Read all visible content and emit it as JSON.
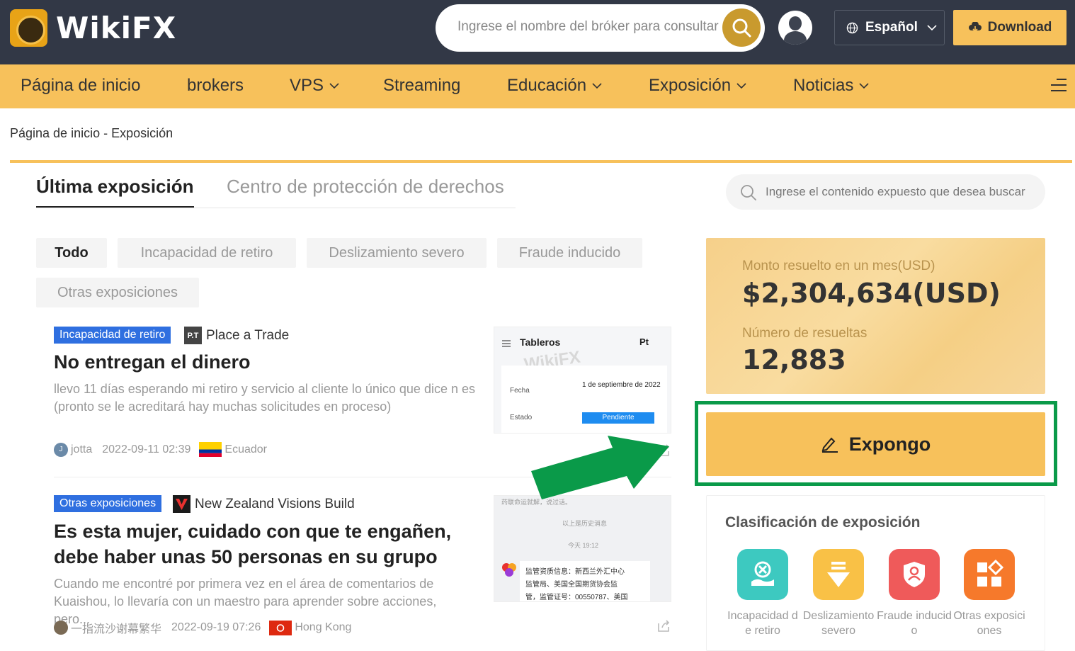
{
  "header": {
    "brand": "WikiFX",
    "search_placeholder": "Ingrese el nombre del bróker para consultar",
    "language": "Español",
    "download": "Download"
  },
  "nav": {
    "items": [
      {
        "label": "Página de inicio"
      },
      {
        "label": "brokers"
      },
      {
        "label": "VPS"
      },
      {
        "label": "Streaming"
      },
      {
        "label": "Educación"
      },
      {
        "label": "Exposición"
      },
      {
        "label": "Noticias"
      }
    ]
  },
  "breadcrumb": "Página de inicio - Exposición",
  "tabs": {
    "active": "Última exposición",
    "other": "Centro de protección de derechos"
  },
  "content_search_placeholder": "Ingrese el contenido expuesto que desea buscar",
  "filters": [
    "Todo",
    "Incapacidad de retiro",
    "Deslizamiento severo",
    "Fraude inducido",
    "Otras exposiciones"
  ],
  "articles": [
    {
      "badge": "Incapacidad de retiro",
      "broker_logo": "P.T",
      "broker": "Place a Trade",
      "title": "No entregan el dinero",
      "desc": "llevo 11 días esperando mi retiro y servicio al cliente lo único que dice n es (pronto se le acreditará hay muchas solicitudes en proceso)",
      "user_initial": "J",
      "user": "jotta",
      "date": "2022-09-11 02:39",
      "country": "Ecuador",
      "thumb": {
        "heading": "Tableros",
        "logo_text": "Pt",
        "watermark": "WikiFX",
        "row1_label": "Fecha",
        "row1_value": "1 de septiembre de 2022",
        "row2_label": "Estado",
        "row2_value": "Pendiente"
      }
    },
    {
      "badge": "Otras exposiciones",
      "broker": "New Zealand Visions Build",
      "title": "Es esta mujer, cuidado con que te engañen, debe haber unas 50 personas en su grupo",
      "desc": "Cuando me encontré por primera vez en el área de comentarios de Kuaishou, lo llevaría con un maestro para aprender sobre acciones, pero...",
      "user": "一指流沙谢幕繁华",
      "date": "2022-09-19 07:26",
      "country": "Hong Kong",
      "thumb": {
        "line1": "药联命运就解，说过话。",
        "line2": "以上是历史消息",
        "line3": "今天 19:12",
        "line4": "监管资质信息：新西兰外汇中心",
        "line5": "监管局、美国全国期货协会监",
        "line6": "管，监管证号：00550787、美国"
      }
    }
  ],
  "stats": {
    "amount_label": "Monto resuelto en un mes(USD)",
    "amount_value": "$2,304,634(USD)",
    "count_label": "Número de resueltas",
    "count_value": "12,883"
  },
  "expose_button": "Expongo",
  "classification": {
    "title": "Clasificación de exposición",
    "items": [
      {
        "label": "Incapacidad de retiro",
        "color": "#3dc9c0"
      },
      {
        "label": "Deslizamiento severo",
        "color": "#f9c146"
      },
      {
        "label": "Fraude inducido",
        "color": "#ef5a5a"
      },
      {
        "label": "Otras exposiciones",
        "color": "#f6792b"
      }
    ]
  },
  "colors": {
    "header_bg": "#323846",
    "accent": "#f7c15b",
    "badge_blue": "#2f6fe0",
    "highlight_green": "#0a9a49"
  }
}
